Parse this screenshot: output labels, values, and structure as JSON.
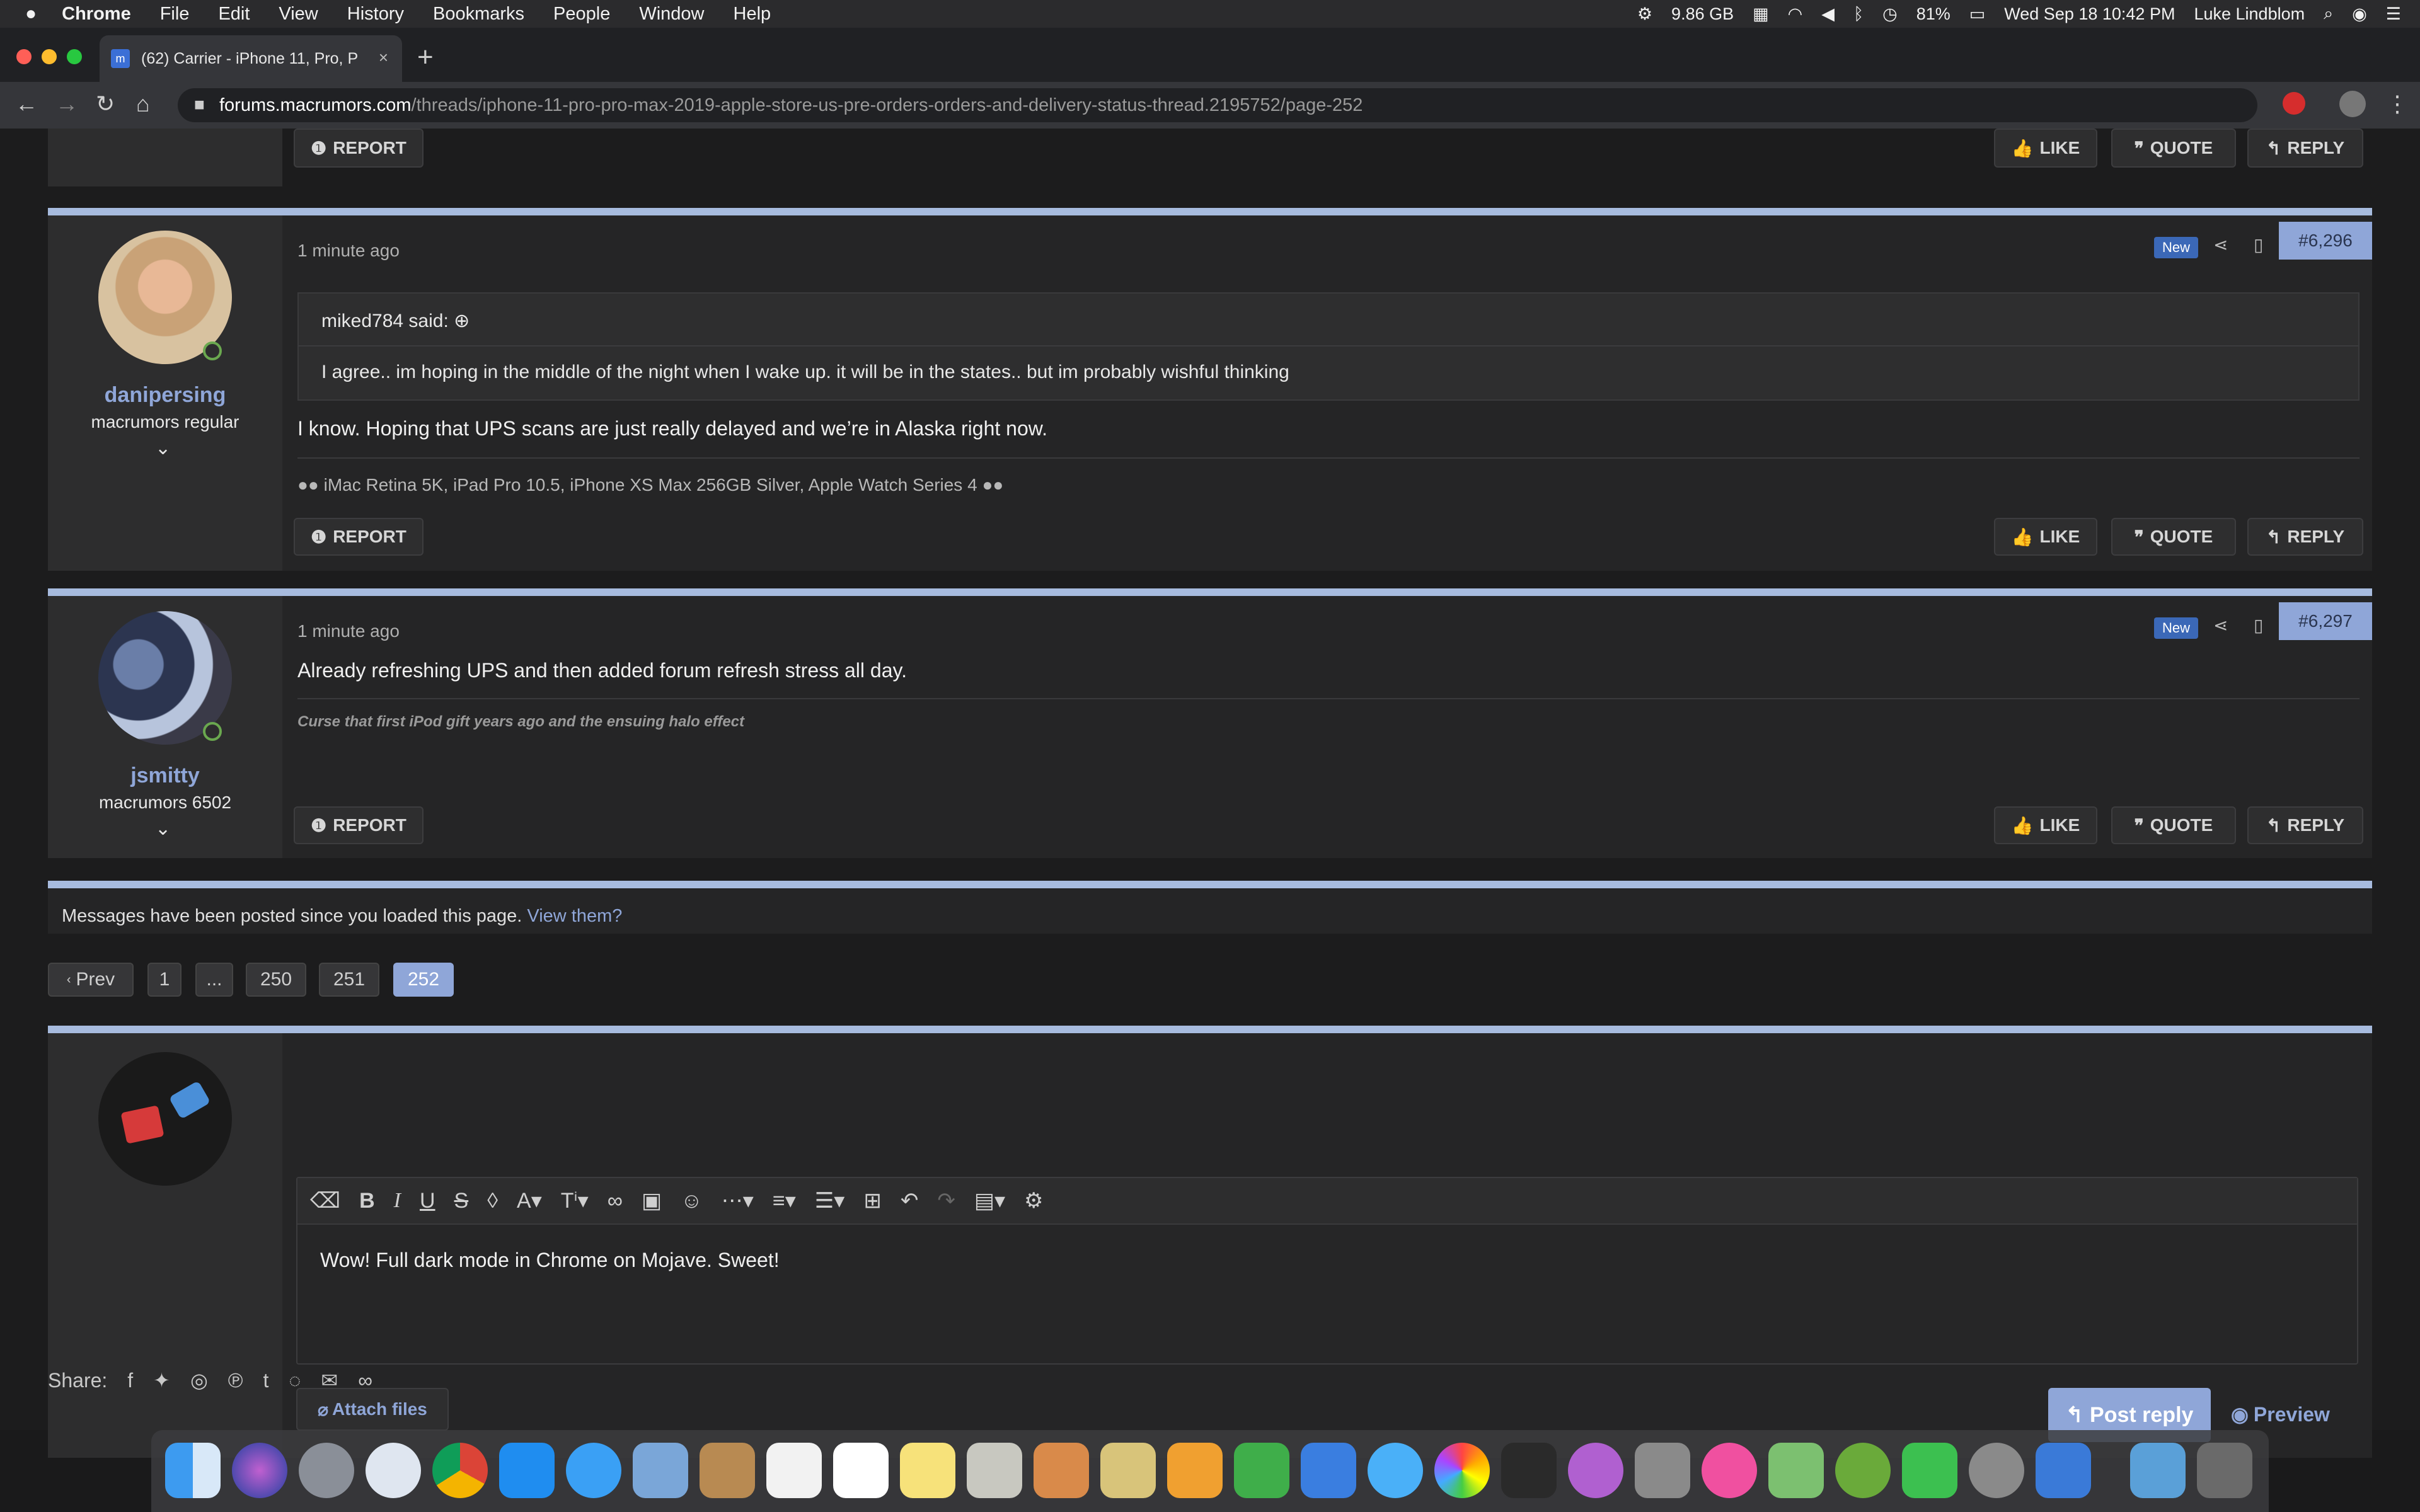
{
  "menubar": {
    "app": "Chrome",
    "items": [
      "File",
      "Edit",
      "View",
      "History",
      "Bookmarks",
      "People",
      "Window",
      "Help"
    ],
    "memory": "9.86 GB",
    "battery": "81%",
    "datetime": "Wed Sep 18  10:42 PM",
    "user": "Luke Lindblom"
  },
  "tab": {
    "title": "(62) Carrier - iPhone 11, Pro, P",
    "close": "×",
    "new": "+"
  },
  "url": {
    "host": "forums.macrumors.com",
    "path": "/threads/iphone-11-pro-pro-max-2019-apple-store-us-pre-orders-orders-and-delivery-status-thread.2195752/page-252"
  },
  "actions": {
    "report": "REPORT",
    "like": "LIKE",
    "quote": "QUOTE",
    "reply": "REPLY"
  },
  "posts": [
    {
      "time": "1 minute ago",
      "new": "New",
      "number": "#6,296",
      "username": "danipersing",
      "usertitle": "macrumors regular",
      "quote_author": "miked784 said:",
      "quote_text": "I agree.. im hoping in the middle of the night when I wake up. it will be in the states.. but im probably wishful thinking",
      "body": "I know. Hoping that UPS scans are just really delayed and we’re in Alaska right now.",
      "signature": "iMac Retina 5K, iPad Pro 10.5, iPhone XS Max 256GB Silver, Apple Watch Series 4"
    },
    {
      "time": "1 minute ago",
      "new": "New",
      "number": "#6,297",
      "username": "jsmitty",
      "usertitle": "macrumors 6502",
      "body": "Already refreshing UPS and then added forum refresh stress all day.",
      "signature": "Curse that first iPod gift years ago and the ensuing halo effect"
    }
  ],
  "notice": {
    "text": "Messages have been posted since you loaded this page.",
    "link": "View them?"
  },
  "pagination": {
    "prev": "Prev",
    "pages": [
      "1",
      "...",
      "250",
      "251",
      "252"
    ],
    "current": "252"
  },
  "editor": {
    "text": "Wow! Full dark mode in Chrome on Mojave. Sweet!"
  },
  "buttons": {
    "attach": "Attach files",
    "post_reply": "Post reply",
    "preview": "Preview"
  },
  "share": {
    "label": "Share:"
  }
}
